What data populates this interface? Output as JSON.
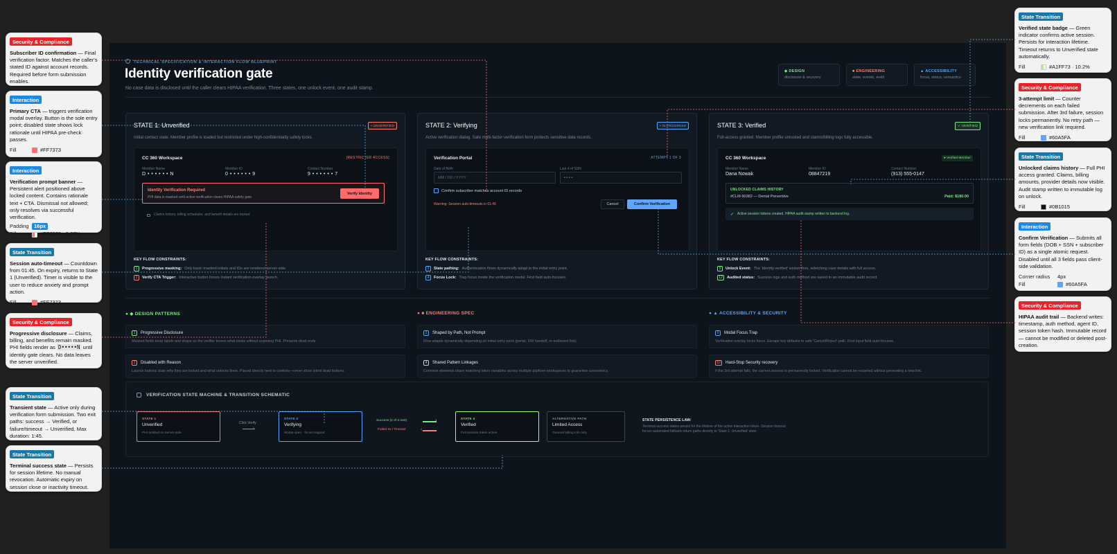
{
  "annotations_left": [
    {
      "tag": "Security & Compliance",
      "title": "Subscriber ID confirmation",
      "text": " — Final verification factor. Matches the caller's stated ID against account records. Required before form submission enables."
    },
    {
      "tag": "Interaction",
      "title": "Primary CTA",
      "text": " — triggers verification modal overlay. Button is the sole entry point; disabled state shows lock rationale until HIPAA pre-check passes.",
      "prop1_k": "Fill",
      "prop1_v": "#FF7373"
    },
    {
      "tag": "Interaction",
      "title": "Verification prompt banner",
      "text": " — Persistent alert positioned above locked content. Contains rationale text + CTA. Dismissal not allowed; only resolves via successful verification.",
      "prop1_k": "Padding",
      "prop1_v": "16px",
      "prop2_k": "Fill",
      "prop2_v": "#FF7373 · 6.27%"
    },
    {
      "tag": "State Transition",
      "title": "Session auto-timeout",
      "text": " — Countdown from 01:45. On expiry, returns to State 1 (Unverified). Timer is visible to the user to reduce anxiety and prompt action.",
      "prop1_k": "Fill",
      "prop1_v": "#FF7373"
    },
    {
      "tag": "Security & Compliance",
      "title": "Progressive disclosure",
      "text_a": " — Claims, billing, and benefits remain masked. PHI fields render as ",
      "mask": "D•••••N",
      "text_b": " until identity gate clears. No data leaves the server unverified."
    },
    {
      "tag": "State Transition",
      "title": "Transient state",
      "text": " — Active only during verification form submission. Two exit paths: success → Verified, or failure/timeout → Unverified. Max duration: 1:45."
    },
    {
      "tag": "State Transition",
      "title": "Terminal success state",
      "text": " — Persists for session lifetime. No manual revocation. Automatic expiry on session close or inactivity timeout."
    }
  ],
  "annotations_right": [
    {
      "tag": "State Transition",
      "title": "Verified state badge",
      "text": " — Green indicator confirms active session. Persists for interaction lifetime. Timeout returns to Unverified state automatically.",
      "prop1_k": "Fill",
      "prop1_v": "#A1FF73 · 10.2%"
    },
    {
      "tag": "Security & Compliance",
      "title": "3-attempt limit",
      "text": " — Counter decrements on each failed submission. After 3rd failure, session locks permanently. No retry path — new verification link required.",
      "prop1_k": "Fill",
      "prop1_v": "#60A5FA"
    },
    {
      "tag": "State Transition",
      "title": "Unlocked claims history",
      "text": " — Full PHI access granted. Claims, billing amounts, provider details now visible. Audit stamp written to immutable log on unlock.",
      "prop1_k": "Fill",
      "prop1_v": "#0B1015"
    },
    {
      "tag": "Interaction",
      "title": "Confirm Verification",
      "text": " — Submits all form fields (DOB + SSN + subscriber ID) as a single atomic request. Disabled until all 3 fields pass client-side validation.",
      "prop1_k": "Corner radius",
      "prop1_v": "4px",
      "prop2_k": "Fill",
      "prop2_v": "#60A5FA"
    },
    {
      "tag": "Security & Compliance",
      "title": "HIPAA audit trail",
      "text": " — Backend writes: timestamp, auth method, agent ID, session token hash. Immutable record — cannot be modified or deleted post-creation."
    }
  ],
  "header": {
    "blueprint": "TECHNICAL SPECIFICATION & INTERACTION FLOW BLUEPRINT",
    "title": "Identity verification gate",
    "subtitle": "No case data is disclosed until the caller clears HIPAA verification. Three states, one unlock event, one audit stamp.",
    "chips": [
      {
        "title": "DESIGN",
        "desc": "disclosure & recovery"
      },
      {
        "title": "ENGINEERING",
        "desc": "state, events, audit"
      },
      {
        "title": "ACCESSIBILITY",
        "desc": "focus, status, semantics"
      }
    ]
  },
  "state1": {
    "title": "STATE 1: Unverified",
    "badge": "• UNVERIFIED",
    "desc": "Initial contact state. Member profile is loaded but restricted under high-confidentiality safety locks.",
    "workspace": "CC 360 Workspace",
    "restricted": "[RESTRICTED ACCESS]",
    "f1_l": "Member Name",
    "f1_v": "D • • • • • • N",
    "f2_l": "Member ID",
    "f2_v": "0 • • • • • • 9",
    "f3_l": "Contact Number",
    "f3_v": "9 • • • • • • 7",
    "alert_title": "Identity Verification Required",
    "alert_text": "PHI data is masked until active verification clears HIPAA safety gate.",
    "alert_btn": "Verify Identity",
    "locked": "Claims history, billing schedules, and benefit details are locked.",
    "kfc": "KEY FLOW CONSTRAINTS:",
    "c1_n": "1",
    "c1_b": "Progressive masking:",
    "c1_t": " Only basic masked initials and IDs are rendered server-side.",
    "c2_n": "2",
    "c2_b": "Verify CTA Trigger:",
    "c2_t": " Interactive button forces instant verification-overlay launch."
  },
  "state2": {
    "title": "STATE 2: Verifying",
    "badge": "• IN-PROGRESS",
    "desc": "Active verification dialog. Safe multi-factor verification form protects sensitive data records.",
    "portal": "Verification Portal",
    "attempt": "ATTEMPT 1 OF 3",
    "dob_l": "Date of Birth",
    "dob_ph": "MM / DD / YYYY",
    "ssn_l": "Last 4 of SSN",
    "ssn_ph": "• • • •",
    "confirm_cb": "Confirm subscriber matches account ID records",
    "warning": "Warning: Session auto-timeouts in 01:45",
    "cancel": "Cancel",
    "confirm": "Confirm Verification",
    "kfc": "KEY FLOW CONSTRAINTS:",
    "c1_n": "3",
    "c1_b": "State pathing:",
    "c1_t": " Authentication flows dynamically adapt to the initial entry point.",
    "c2_n": "4",
    "c2_b": "Focus Lock:",
    "c2_t": " Trap focus inside the verification modal. First field auto-focuses."
  },
  "state3": {
    "title": "STATE 3: Verified",
    "badge": "✓ VERIFIED",
    "desc": "Full-access granted. Member profile unlocked and claims/billing logs fully accessible.",
    "workspace": "CC 360 Workspace",
    "member_badge": "● Verified Member",
    "f1_l": "Member Name",
    "f1_v": "Dana Nowak",
    "f2_l": "Member ID",
    "f2_v": "08847219",
    "f3_l": "Contact Number",
    "f3_v": "(913) 555-0147",
    "claims_h": "UNLOCKED CLAIMS HISTORY",
    "claim": "#CLM-90382 — Dental Preventive",
    "paid": "Paid: $180.00",
    "session": "Active session tokens created. HIPAA audit-stamp written to backend log.",
    "kfc": "KEY FLOW CONSTRAINTS:",
    "c1_n": "5",
    "c1_b": "Unlock Event:",
    "c1_t": " The 'identity.verified' socket fires, refetching case details with full access.",
    "c2_n": "12",
    "c2_b": "Audited status:",
    "c2_t": " Success logs and auth method are saved to an immutable audit record."
  },
  "patterns": {
    "design_h": "DESIGN PATTERNS",
    "eng_h": "ENGINEERING SPEC",
    "acc_h": "ACCESSIBILITY & SECURITY",
    "d1_n": "1",
    "d1_t": "Progressive Disclosure",
    "d1_d": "Masked fields keep labels and shape so the verifier knows what exists without exposing PHI. Prevents dead ends.",
    "d2_n": "2",
    "d2_t": "Disabled with Reason",
    "d2_d": "Launch buttons state why they are locked and what unlocks them. Placed directly next to controls—never show silent dead buttons.",
    "e1_n": "3",
    "e1_t": "Shaped by Path, Not Prompt",
    "e1_d": "Flow adapts dynamically depending on initial entry point (portal, IVR handoff, or outbound link).",
    "e2_n": "4",
    "e2_t": "Shared Pattern Linkages",
    "e2_d": "Common elements share matching token variables across multiple platform workspaces to guarantee consistency.",
    "a1_n": "9",
    "a1_t": "Modal Focus Trap",
    "a1_d": "Verification overlay locks focus. Escape key defaults to safe 'Cancel/Reject' path. First input field auto-focuses.",
    "a2_n": "10",
    "a2_t": "Hard-Stop Security recovery",
    "a2_d": "If the 3rd attempt fails, the current session is permanently locked. Verification cannot be restarted without generating a new link."
  },
  "machine": {
    "title": "VERIFICATION STATE MACHINE & TRANSITION SCHEMATIC",
    "n1_a": "STATE 1",
    "n1_b": "Unverified",
    "n1_c": "PHI omitted on server-side",
    "n2_a": "STATE 2",
    "n2_b": "Verifying",
    "n2_c": "Modal open · focus trapped",
    "n3_a": "STATE 3",
    "n3_b": "Verified",
    "n3_c": "Full session token active",
    "n4_a": "ALTERNATIVE PATH",
    "n4_b": "Limited Access",
    "n4_c": "General billing info only",
    "click_verify": "Click Verify",
    "success": "Success (2 of 3 met)",
    "failed": "Failed 3x / Timeout",
    "law_h": "STATE PERSISTENCE LAW:",
    "law_d": "Terminal success states persist for the lifetime of the active interaction token. Session timeout forces automated fallback return paths directly to 'State 1: Unverified' state."
  },
  "colors": {
    "red": "#FF7373",
    "blue": "#60A5FA",
    "green": "#A1FF73",
    "dark": "#0B1015"
  }
}
